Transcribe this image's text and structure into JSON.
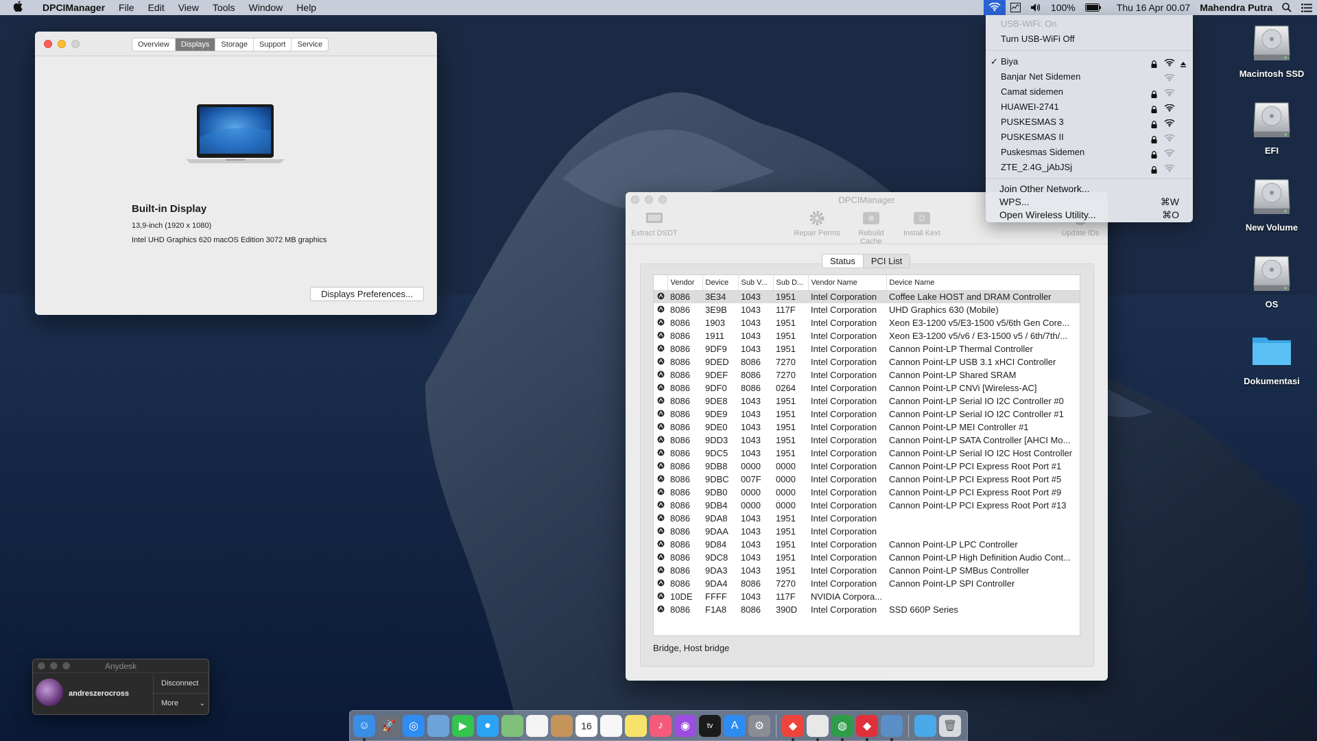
{
  "menubar": {
    "app_name": "DPCIManager",
    "menus": [
      "File",
      "Edit",
      "View",
      "Tools",
      "Window",
      "Help"
    ],
    "battery": "100%",
    "datetime": "Thu 16 Apr  00.07",
    "user": "Mahendra Putra",
    "icons": [
      "wifi-icon",
      "activity-monitor-icon",
      "volume-icon",
      "battery-icon",
      "spotlight-icon",
      "notification-center-icon"
    ]
  },
  "wifi_menu": {
    "status": "USB-WiFi: On",
    "toggle": "Turn USB-WiFi Off",
    "networks": [
      {
        "name": "Biya",
        "locked": true,
        "connected": true
      },
      {
        "name": "Banjar Net Sidemen",
        "locked": false,
        "connected": false
      },
      {
        "name": "Camat sidemen",
        "locked": true,
        "connected": false
      },
      {
        "name": "HUAWEI-2741",
        "locked": true,
        "connected": false
      },
      {
        "name": "PUSKESMAS 3",
        "locked": true,
        "connected": false
      },
      {
        "name": "PUSKESMAS II",
        "locked": true,
        "connected": false
      },
      {
        "name": "Puskesmas Sidemen",
        "locked": true,
        "connected": false
      },
      {
        "name": "ZTE_2.4G_jAbJSj",
        "locked": true,
        "connected": false
      }
    ],
    "join_other": "Join Other Network...",
    "wps": "WPS...",
    "wps_shortcut": "⌘W",
    "open_utility": "Open Wireless Utility...",
    "open_utility_shortcut": "⌘O"
  },
  "desktop_icons": [
    {
      "label": "Macintosh SSD",
      "icon": "hard-drive-icon"
    },
    {
      "label": "EFI",
      "icon": "hard-drive-icon"
    },
    {
      "label": "New Volume",
      "icon": "hard-drive-icon"
    },
    {
      "label": "OS",
      "icon": "hard-drive-icon"
    },
    {
      "label": "Dokumentasi",
      "icon": "folder-icon"
    }
  ],
  "about_window": {
    "tabs": [
      "Overview",
      "Displays",
      "Storage",
      "Support",
      "Service"
    ],
    "active_tab": "Displays",
    "display_title": "Built-in Display",
    "display_size": "13,9-inch (1920 x 1080)",
    "graphics": "Intel UHD Graphics 620 macOS Edition 3072 MB graphics",
    "prefs_button": "Displays Preferences..."
  },
  "dpci_window": {
    "title": "DPCIManager",
    "toolbar": {
      "extract": "Extract DSDT",
      "repair": "Repair Perms",
      "rebuild": "Rebuild Cache",
      "install": "Install Kext",
      "update": "Update IDs"
    },
    "segments": [
      "Status",
      "PCI List"
    ],
    "active_segment": "PCI List",
    "columns": [
      "Vendor",
      "Device",
      "Sub V...",
      "Sub D...",
      "Vendor Name",
      "Device Name"
    ],
    "rows": [
      [
        "8086",
        "3E34",
        "1043",
        "1951",
        "Intel Corporation",
        "Coffee Lake HOST and DRAM Controller"
      ],
      [
        "8086",
        "3E9B",
        "1043",
        "117F",
        "Intel Corporation",
        "UHD Graphics 630 (Mobile)"
      ],
      [
        "8086",
        "1903",
        "1043",
        "1951",
        "Intel Corporation",
        "Xeon E3-1200 v5/E3-1500 v5/6th Gen Core..."
      ],
      [
        "8086",
        "1911",
        "1043",
        "1951",
        "Intel Corporation",
        "Xeon E3-1200 v5/v6 / E3-1500 v5 / 6th/7th/..."
      ],
      [
        "8086",
        "9DF9",
        "1043",
        "1951",
        "Intel Corporation",
        "Cannon Point-LP Thermal Controller"
      ],
      [
        "8086",
        "9DED",
        "8086",
        "7270",
        "Intel Corporation",
        "Cannon Point-LP USB 3.1 xHCI Controller"
      ],
      [
        "8086",
        "9DEF",
        "8086",
        "7270",
        "Intel Corporation",
        "Cannon Point-LP Shared SRAM"
      ],
      [
        "8086",
        "9DF0",
        "8086",
        "0264",
        "Intel Corporation",
        "Cannon Point-LP CNVi [Wireless-AC]"
      ],
      [
        "8086",
        "9DE8",
        "1043",
        "1951",
        "Intel Corporation",
        "Cannon Point-LP Serial IO I2C Controller #0"
      ],
      [
        "8086",
        "9DE9",
        "1043",
        "1951",
        "Intel Corporation",
        "Cannon Point-LP Serial IO I2C Controller #1"
      ],
      [
        "8086",
        "9DE0",
        "1043",
        "1951",
        "Intel Corporation",
        "Cannon Point-LP MEI Controller #1"
      ],
      [
        "8086",
        "9DD3",
        "1043",
        "1951",
        "Intel Corporation",
        "Cannon Point-LP SATA Controller [AHCI Mo..."
      ],
      [
        "8086",
        "9DC5",
        "1043",
        "1951",
        "Intel Corporation",
        "Cannon Point-LP Serial IO I2C Host Controller"
      ],
      [
        "8086",
        "9DB8",
        "0000",
        "0000",
        "Intel Corporation",
        "Cannon Point-LP PCI Express Root Port #1"
      ],
      [
        "8086",
        "9DBC",
        "007F",
        "0000",
        "Intel Corporation",
        "Cannon Point-LP PCI Express Root Port #5"
      ],
      [
        "8086",
        "9DB0",
        "0000",
        "0000",
        "Intel Corporation",
        "Cannon Point-LP PCI Express Root Port #9"
      ],
      [
        "8086",
        "9DB4",
        "0000",
        "0000",
        "Intel Corporation",
        "Cannon Point-LP PCI Express Root Port #13"
      ],
      [
        "8086",
        "9DA8",
        "1043",
        "1951",
        "Intel Corporation",
        ""
      ],
      [
        "8086",
        "9DAA",
        "1043",
        "1951",
        "Intel Corporation",
        ""
      ],
      [
        "8086",
        "9D84",
        "1043",
        "1951",
        "Intel Corporation",
        "Cannon Point-LP LPC Controller"
      ],
      [
        "8086",
        "9DC8",
        "1043",
        "1951",
        "Intel Corporation",
        "Cannon Point-LP High Definition Audio Cont..."
      ],
      [
        "8086",
        "9DA3",
        "1043",
        "1951",
        "Intel Corporation",
        "Cannon Point-LP SMBus Controller"
      ],
      [
        "8086",
        "9DA4",
        "8086",
        "7270",
        "Intel Corporation",
        "Cannon Point-LP SPI Controller"
      ],
      [
        "10DE",
        "FFFF",
        "1043",
        "117F",
        "NVIDIA Corpora...",
        ""
      ],
      [
        "8086",
        "F1A8",
        "8086",
        "390D",
        "Intel Corporation",
        "SSD 660P Series"
      ]
    ],
    "status_text": "Bridge, Host bridge"
  },
  "anydesk": {
    "title": "Anydesk",
    "user": "andreszerocross",
    "disconnect": "Disconnect",
    "more": "More"
  },
  "dock": {
    "apps": [
      "finder-icon",
      "launchpad-icon",
      "safari-icon",
      "mail-preview-icon",
      "facetime-icon",
      "messages-icon",
      "maps-icon",
      "photos-icon",
      "contacts-icon",
      "calendar-icon",
      "reminders-icon",
      "notes-icon",
      "music-icon",
      "podcasts-icon",
      "tv-icon",
      "app-store-icon",
      "system-preferences-icon",
      "anydesk-icon",
      "textedit-icon",
      "dpcimanager-icon",
      "anydesk-red-icon",
      "network-icon",
      "downloads-folder-icon",
      "trash-icon"
    ],
    "calendar_day": "16"
  }
}
